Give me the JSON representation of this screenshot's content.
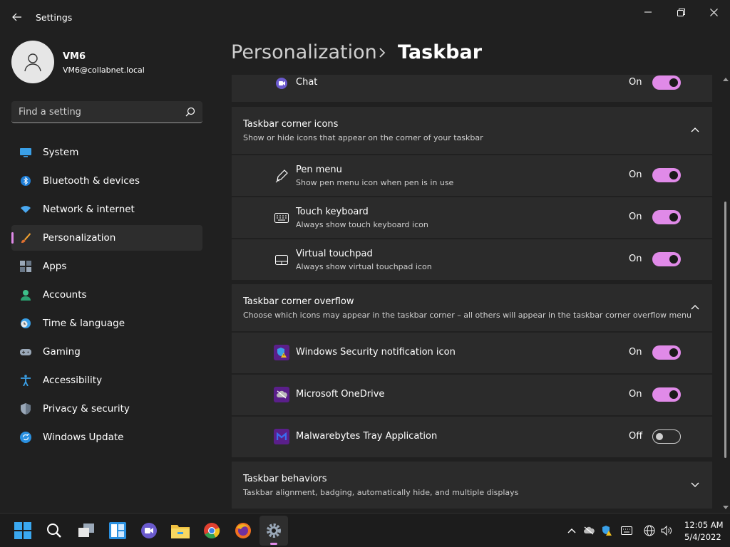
{
  "window": {
    "title": "Settings"
  },
  "user": {
    "name": "VM6",
    "email": "VM6@collabnet.local"
  },
  "search": {
    "placeholder": "Find a setting"
  },
  "sidebar": {
    "items": [
      {
        "label": "System",
        "icon": "system-icon"
      },
      {
        "label": "Bluetooth & devices",
        "icon": "bluetooth-icon"
      },
      {
        "label": "Network & internet",
        "icon": "wifi-icon"
      },
      {
        "label": "Personalization",
        "icon": "brush-icon",
        "active": true
      },
      {
        "label": "Apps",
        "icon": "apps-icon"
      },
      {
        "label": "Accounts",
        "icon": "accounts-icon"
      },
      {
        "label": "Time & language",
        "icon": "clock-globe-icon"
      },
      {
        "label": "Gaming",
        "icon": "gamepad-icon"
      },
      {
        "label": "Accessibility",
        "icon": "accessibility-icon"
      },
      {
        "label": "Privacy & security",
        "icon": "shield-icon"
      },
      {
        "label": "Windows Update",
        "icon": "update-icon"
      }
    ]
  },
  "breadcrumb": {
    "parent": "Personalization",
    "current": "Taskbar"
  },
  "chat_row": {
    "label": "Chat",
    "state": "On"
  },
  "corner_icons": {
    "title": "Taskbar corner icons",
    "description": "Show or hide icons that appear on the corner of your taskbar",
    "items": [
      {
        "title": "Pen menu",
        "desc": "Show pen menu icon when pen is in use",
        "state": "On"
      },
      {
        "title": "Touch keyboard",
        "desc": "Always show touch keyboard icon",
        "state": "On"
      },
      {
        "title": "Virtual touchpad",
        "desc": "Always show virtual touchpad icon",
        "state": "On"
      }
    ]
  },
  "corner_overflow": {
    "title": "Taskbar corner overflow",
    "description": "Choose which icons may appear in the taskbar corner – all others will appear in the taskbar corner overflow menu",
    "items": [
      {
        "title": "Windows Security notification icon",
        "state": "On"
      },
      {
        "title": "Microsoft OneDrive",
        "state": "On"
      },
      {
        "title": "Malwarebytes Tray Application",
        "state": "Off"
      }
    ]
  },
  "behaviors": {
    "title": "Taskbar behaviors",
    "description": "Taskbar alignment, badging, automatically hide, and multiple displays"
  },
  "taskbar": {
    "clock_time": "12:05 AM",
    "clock_date": "5/4/2022"
  },
  "colors": {
    "accent": "#e08ae8",
    "background": "#202020",
    "card": "#2b2b2b"
  }
}
